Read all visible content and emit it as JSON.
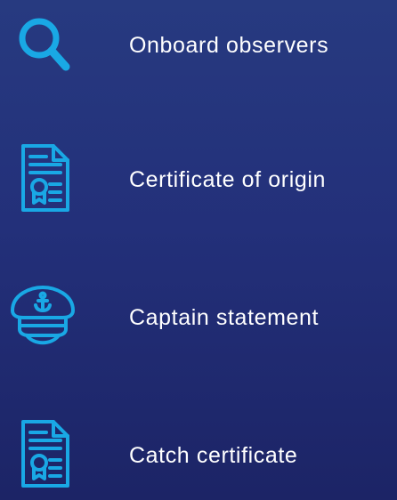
{
  "items": [
    {
      "label": "Onboard observers",
      "icon": "search-icon"
    },
    {
      "label": "Certificate of origin",
      "icon": "certificate-icon"
    },
    {
      "label": "Captain statement",
      "icon": "captain-hat-icon"
    },
    {
      "label": "Catch certificate",
      "icon": "certificate-icon"
    }
  ],
  "colors": {
    "background_top": "#273a80",
    "background_bottom": "#1c2466",
    "icon_accent": "#19a8e5",
    "text": "#ffffff"
  }
}
